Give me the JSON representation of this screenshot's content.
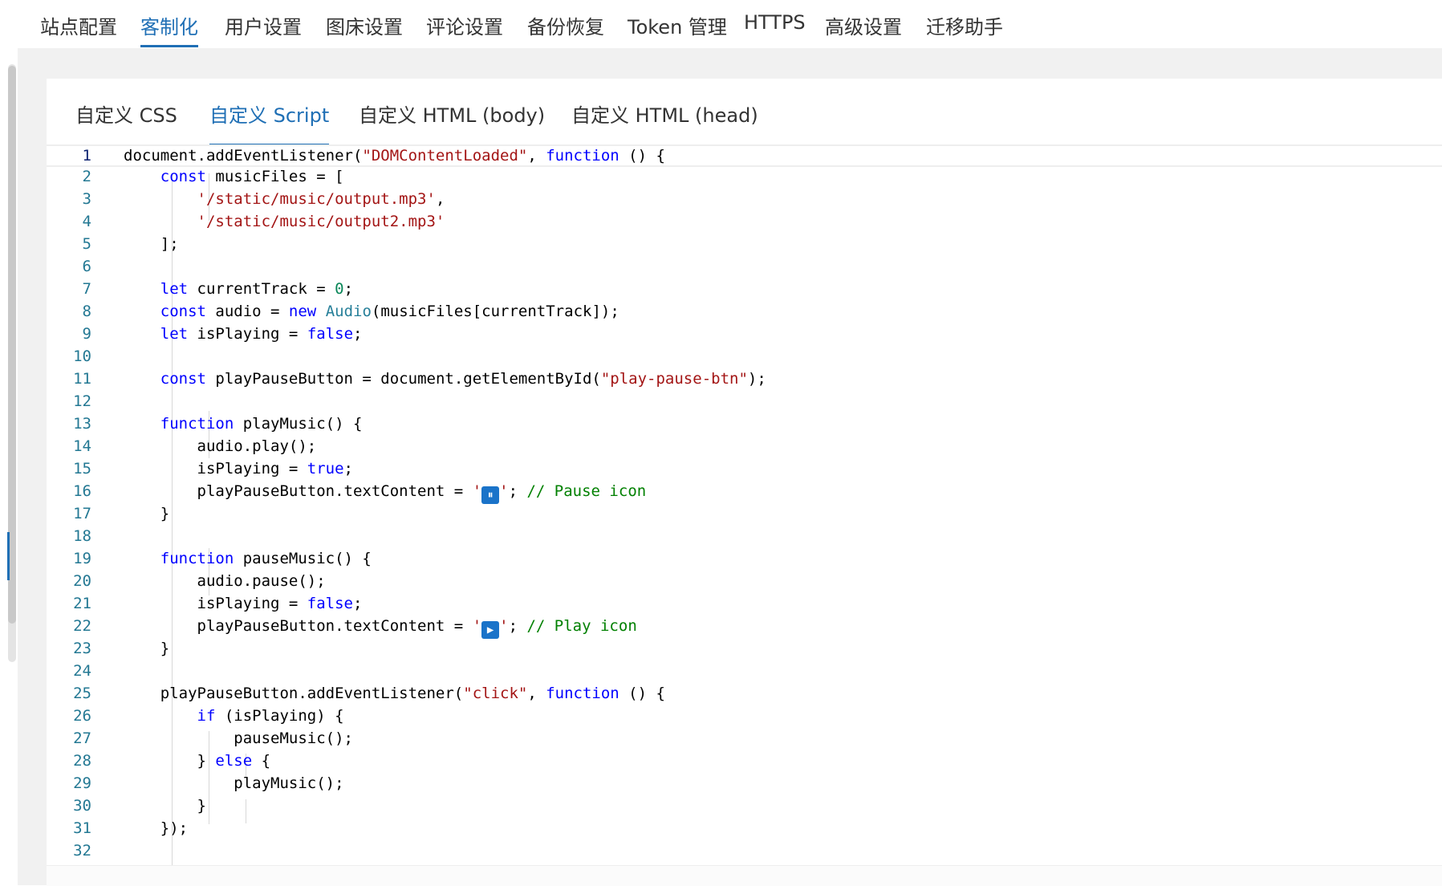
{
  "top_tabs": [
    {
      "label": "站点配置",
      "active": false
    },
    {
      "label": "客制化",
      "active": true
    },
    {
      "label": "用户设置",
      "active": false
    },
    {
      "label": "图床设置",
      "active": false
    },
    {
      "label": "评论设置",
      "active": false
    },
    {
      "label": "备份恢复",
      "active": false
    },
    {
      "label": "Token 管理",
      "active": false
    },
    {
      "label": "HTTPS",
      "active": false
    },
    {
      "label": "高级设置",
      "active": false
    },
    {
      "label": "迁移助手",
      "active": false
    }
  ],
  "inner_tabs": [
    {
      "label": "自定义 CSS",
      "active": false
    },
    {
      "label": "自定义 Script",
      "active": true
    },
    {
      "label": "自定义 HTML (body)",
      "active": false
    },
    {
      "label": "自定义 HTML (head)",
      "active": false
    }
  ],
  "editor": {
    "current_line": 1,
    "line_numbers": [
      "1",
      "2",
      "3",
      "4",
      "5",
      "6",
      "7",
      "8",
      "9",
      "10",
      "11",
      "12",
      "13",
      "14",
      "15",
      "16",
      "17",
      "18",
      "19",
      "20",
      "21",
      "22",
      "23",
      "24",
      "25",
      "26",
      "27",
      "28",
      "29",
      "30",
      "31",
      "32"
    ],
    "code": {
      "l1_a": "document.addEventListener(",
      "l1_b": "\"DOMContentLoaded\"",
      "l1_c": ", ",
      "l1_d": "function",
      "l1_e": " () {",
      "l2_a": "    ",
      "l2_b": "const",
      "l2_c": " musicFiles = [",
      "l3_a": "        ",
      "l3_b": "'/static/music/output.mp3'",
      "l3_c": ",",
      "l4_a": "        ",
      "l4_b": "'/static/music/output2.mp3'",
      "l5": "    ];",
      "l7_a": "    ",
      "l7_b": "let",
      "l7_c": " currentTrack = ",
      "l7_d": "0",
      "l7_e": ";",
      "l8_a": "    ",
      "l8_b": "const",
      "l8_c": " audio = ",
      "l8_d": "new",
      "l8_e": " ",
      "l8_f": "Audio",
      "l8_g": "(musicFiles[currentTrack]);",
      "l9_a": "    ",
      "l9_b": "let",
      "l9_c": " isPlaying = ",
      "l9_d": "false",
      "l9_e": ";",
      "l11_a": "    ",
      "l11_b": "const",
      "l11_c": " playPauseButton = document.getElementById(",
      "l11_d": "\"play-pause-btn\"",
      "l11_e": ");",
      "l13_a": "    ",
      "l13_b": "function",
      "l13_c": " playMusic() {",
      "l14": "        audio.play();",
      "l15_a": "        isPlaying = ",
      "l15_b": "true",
      "l15_c": ";",
      "l16_a": "        playPauseButton.textContent = ",
      "l16_b": "'",
      "l16_emoji": "⏸",
      "l16_c": "'",
      "l16_d": "; ",
      "l16_e": "// Pause icon",
      "l17": "    }",
      "l19_a": "    ",
      "l19_b": "function",
      "l19_c": " pauseMusic() {",
      "l20": "        audio.pause();",
      "l21_a": "        isPlaying = ",
      "l21_b": "false",
      "l21_c": ";",
      "l22_a": "        playPauseButton.textContent = ",
      "l22_b": "'",
      "l22_emoji": "▶",
      "l22_c": "'",
      "l22_d": "; ",
      "l22_e": "// Play icon",
      "l23": "    }",
      "l25_a": "    playPauseButton.addEventListener(",
      "l25_b": "\"click\"",
      "l25_c": ", ",
      "l25_d": "function",
      "l25_e": " () {",
      "l26_a": "        ",
      "l26_b": "if",
      "l26_c": " (isPlaying) {",
      "l27": "            pauseMusic();",
      "l28_a": "        } ",
      "l28_b": "else",
      "l28_c": " {",
      "l29": "            playMusic();",
      "l30": "        }",
      "l31": "    });"
    }
  },
  "colors": {
    "accent": "#1f6fb5",
    "keyword": "#0000ff",
    "string": "#a31515",
    "number": "#098658",
    "class": "#267f99",
    "comment": "#008000",
    "line_number": "#237893"
  }
}
